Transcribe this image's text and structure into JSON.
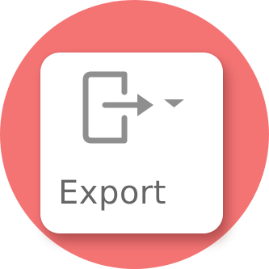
{
  "export_button": {
    "label": "Export",
    "icon": "export-icon",
    "caret_icon": "caret-down-icon"
  },
  "colors": {
    "background_circle": "#f47474",
    "card": "#ffffff",
    "icon": "#8f8f8f",
    "label_text": "#666666"
  }
}
